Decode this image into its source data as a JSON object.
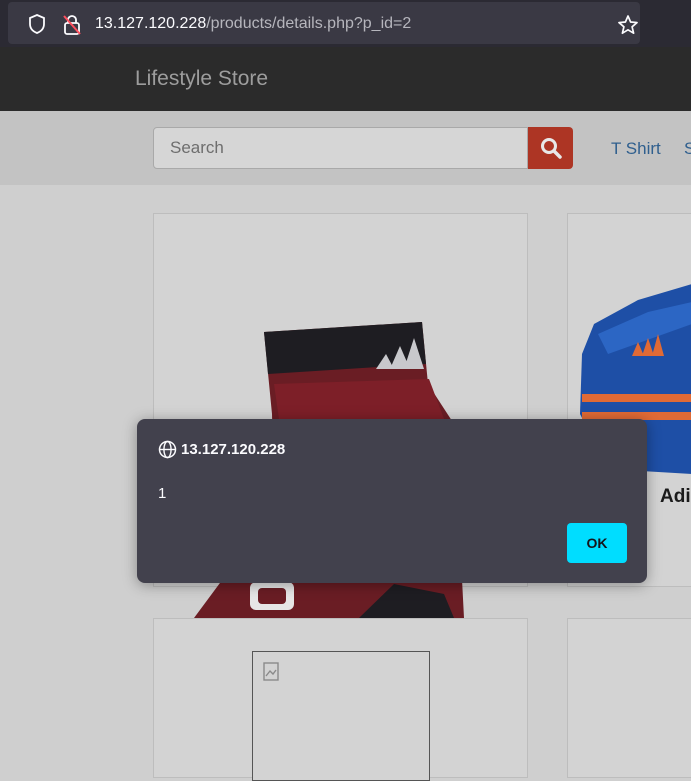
{
  "browser": {
    "url_host": "13.127.120.228",
    "url_path": "/products/details.php?p_id=2"
  },
  "site": {
    "brand": "Lifestyle Store",
    "search_placeholder": "Search",
    "categories": [
      "T Shirt",
      "S"
    ]
  },
  "products": [
    {
      "title": ""
    },
    {
      "title": "Adi"
    }
  ],
  "dialog": {
    "origin": "13.127.120.228",
    "message": "1",
    "ok_label": "OK"
  },
  "colors": {
    "accent_ok": "#00ddff",
    "search_button": "#ad3524",
    "link": "#2f5f8e"
  }
}
